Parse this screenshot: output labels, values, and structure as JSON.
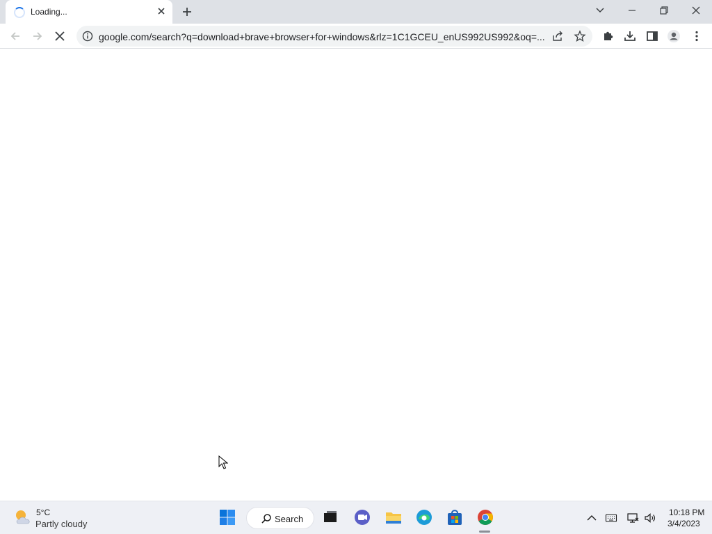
{
  "tab": {
    "title": "Loading..."
  },
  "toolbar": {
    "url": "google.com/search?q=download+brave+browser+for+windows&rlz=1C1GCEU_enUS992US992&oq=..."
  },
  "taskbar": {
    "weather": {
      "temp": "5°C",
      "desc": "Partly cloudy"
    },
    "search_label": "Search",
    "clock": {
      "time": "10:18 PM",
      "date": "3/4/2023"
    }
  },
  "colors": {
    "tabstrip": "#dee1e6",
    "accent": "#1a73e8",
    "taskbar": "#eef0f5"
  }
}
